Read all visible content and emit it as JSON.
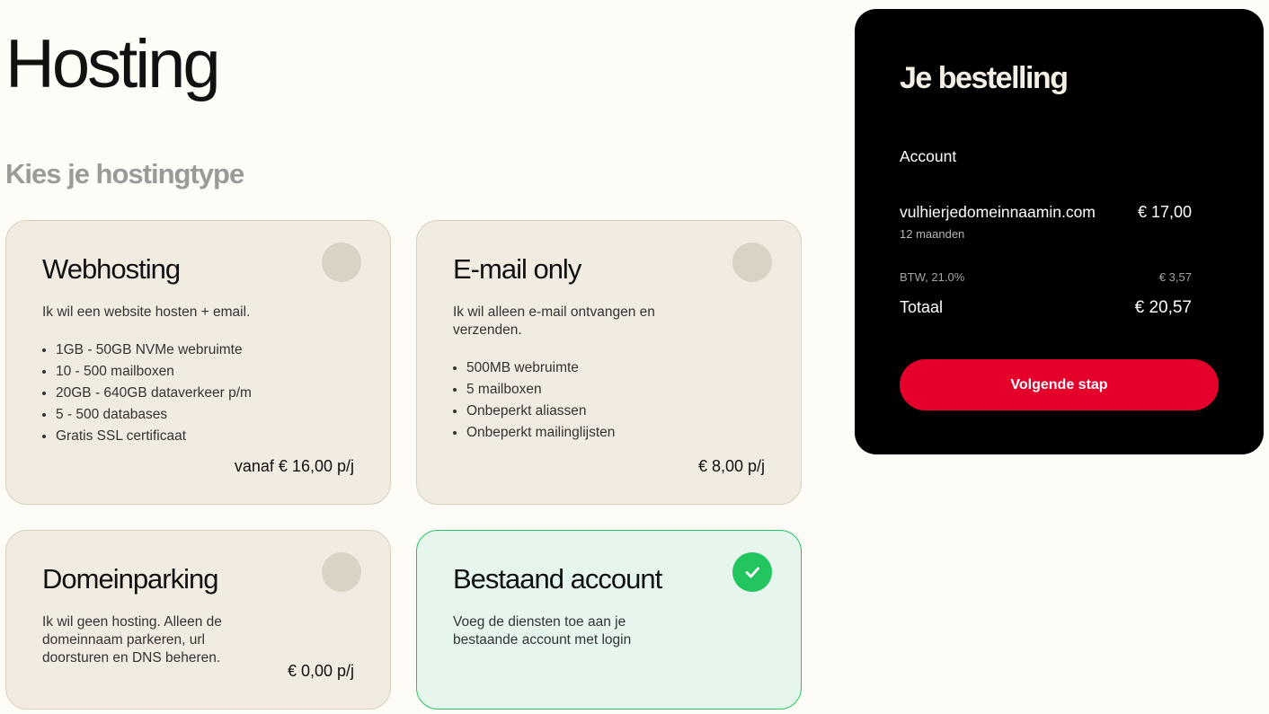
{
  "page": {
    "title": "Hosting",
    "subtitle": "Kies je hostingtype"
  },
  "plans": [
    {
      "name": "Webhosting",
      "description": "Ik wil een website hosten + email.",
      "features": [
        "1GB - 50GB NVMe webruimte",
        "10 - 500 mailboxen",
        "20GB - 640GB dataverkeer p/m",
        "5 - 500 databases",
        "Gratis SSL certificaat"
      ],
      "price": "vanaf € 16,00 p/j",
      "selected": false
    },
    {
      "name": "E-mail only",
      "description": "Ik wil alleen e-mail ontvangen en verzenden.",
      "features": [
        "500MB webruimte",
        "5 mailboxen",
        "Onbeperkt aliassen",
        "Onbeperkt mailinglijsten"
      ],
      "price": "€ 8,00 p/j",
      "selected": false
    },
    {
      "name": "Domeinparking",
      "description": "Ik wil geen hosting. Alleen de domeinnaam parkeren, url doorsturen en DNS beheren.",
      "features": [],
      "price": "€ 0,00 p/j",
      "selected": false
    },
    {
      "name": "Bestaand account",
      "description": "Voeg de diensten toe aan je bestaande account met login",
      "features": [],
      "price": "",
      "selected": true
    }
  ],
  "order": {
    "title": "Je bestelling",
    "section": "Account",
    "item_name": "vulhierjedomeinnaamin.com",
    "item_price": "€ 17,00",
    "item_period": "12 maanden",
    "tax_label": "BTW, 21.0%",
    "tax_value": "€ 3,57",
    "total_label": "Totaal",
    "total_value": "€ 20,57",
    "next_label": "Volgende stap"
  },
  "colors": {
    "background": "#fdfcf7",
    "card": "#f2ebe1",
    "selected_card": "#e6f6ec",
    "check": "#22c55e",
    "order_panel": "#000000",
    "primary_button": "#e4002b"
  }
}
